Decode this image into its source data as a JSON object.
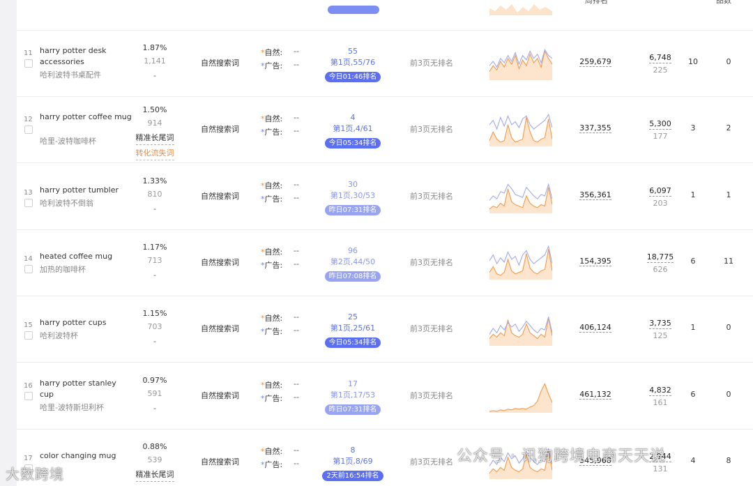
{
  "header": {
    "search_rank_label": "周排名",
    "last_col_label": "品数"
  },
  "labels": {
    "natural": "自然:",
    "ad": "广告:",
    "no_rank": "前3页无排名",
    "star": "*"
  },
  "rows": [
    {
      "index": "11",
      "keyword": "harry potter desk accessories",
      "translation": "哈利波特书桌配件",
      "ratio": "1.87%",
      "count": "1,141",
      "tag1": "-",
      "tag2": "",
      "type": "自然搜索词",
      "natural_val": "--",
      "ad_val": "--",
      "rank": "55",
      "rank_page": "第1页,55/76",
      "rank_time": "今日01:46排名",
      "rank_today": true,
      "search_volume": "259,679",
      "pw_a": "6,748",
      "pw_b": "225",
      "c1": "10",
      "c2": "0",
      "trend_orange": [
        12,
        20,
        14,
        26,
        18,
        30,
        22,
        34,
        16,
        28,
        20,
        36,
        24,
        30,
        18,
        40,
        30,
        22
      ],
      "trend_blue": [
        20,
        26,
        18,
        30,
        24,
        34,
        26,
        38,
        22,
        34,
        28,
        40,
        30,
        36,
        24,
        42,
        34,
        30
      ]
    },
    {
      "index": "12",
      "keyword": "harry potter coffee mug",
      "translation": "哈里-波特咖啡杯",
      "ratio": "1.50%",
      "count": "914",
      "tag1": "精准长尾词",
      "tag2": "转化流失词",
      "type": "自然搜索词",
      "natural_val": "--",
      "ad_val": "--",
      "rank": "4",
      "rank_page": "第1页,4/61",
      "rank_time": "今日05:34排名",
      "rank_today": true,
      "search_volume": "337,355",
      "pw_a": "5,300",
      "pw_b": "177",
      "c1": "3",
      "c2": "2",
      "trend_orange": [
        8,
        20,
        10,
        6,
        8,
        30,
        12,
        6,
        8,
        10,
        40,
        20,
        8,
        6,
        10,
        12,
        38,
        10
      ],
      "trend_blue": [
        30,
        36,
        24,
        40,
        28,
        42,
        30,
        34,
        26,
        38,
        42,
        30,
        24,
        28,
        32,
        36,
        44,
        26
      ]
    },
    {
      "index": "13",
      "keyword": "harry potter tumbler",
      "translation": "哈利波特不倒翁",
      "ratio": "1.33%",
      "count": "810",
      "tag1": "-",
      "tag2": "",
      "type": "自然搜索词",
      "natural_val": "--",
      "ad_val": "--",
      "rank": "30",
      "rank_page": "第1页,30/53",
      "rank_time": "昨日07:31排名",
      "rank_today": false,
      "search_volume": "356,361",
      "pw_a": "6,097",
      "pw_b": "203",
      "c1": "1",
      "c2": "1",
      "trend_orange": [
        6,
        10,
        8,
        14,
        10,
        34,
        16,
        12,
        10,
        8,
        24,
        14,
        10,
        8,
        12,
        10,
        36,
        12
      ],
      "trend_blue": [
        18,
        24,
        20,
        30,
        28,
        40,
        34,
        26,
        24,
        22,
        36,
        30,
        24,
        20,
        26,
        24,
        40,
        20
      ]
    },
    {
      "index": "14",
      "keyword": "heated coffee mug",
      "translation": "加热的咖啡杯",
      "ratio": "1.17%",
      "count": "713",
      "tag1": "-",
      "tag2": "",
      "type": "自然搜索词",
      "natural_val": "--",
      "ad_val": "--",
      "rank": "96",
      "rank_page": "第2页,44/50",
      "rank_time": "昨日07:08排名",
      "rank_today": false,
      "search_volume": "154,395",
      "pw_a": "18,775",
      "pw_b": "626",
      "c1": "6",
      "c2": "11",
      "trend_orange": [
        10,
        18,
        8,
        6,
        10,
        28,
        12,
        8,
        10,
        12,
        36,
        16,
        10,
        8,
        12,
        14,
        42,
        12
      ],
      "trend_blue": [
        26,
        34,
        22,
        30,
        24,
        38,
        28,
        32,
        20,
        34,
        40,
        28,
        22,
        26,
        30,
        34,
        46,
        22
      ]
    },
    {
      "index": "15",
      "keyword": "harry potter cups",
      "translation": "哈利波特杯",
      "ratio": "1.15%",
      "count": "703",
      "tag1": "-",
      "tag2": "",
      "type": "自然搜索词",
      "natural_val": "--",
      "ad_val": "--",
      "rank": "25",
      "rank_page": "第1页,25/61",
      "rank_time": "今日05:34排名",
      "rank_today": true,
      "search_volume": "406,124",
      "pw_a": "3,735",
      "pw_b": "125",
      "c1": "1",
      "c2": "0",
      "trend_orange": [
        10,
        16,
        12,
        18,
        14,
        36,
        18,
        14,
        12,
        16,
        30,
        18,
        14,
        10,
        16,
        12,
        38,
        14
      ],
      "trend_blue": [
        16,
        24,
        18,
        28,
        22,
        32,
        26,
        30,
        20,
        26,
        34,
        28,
        22,
        18,
        24,
        22,
        40,
        18
      ]
    },
    {
      "index": "16",
      "keyword": "harry potter stanley cup",
      "translation": "哈里-波特斯坦利杯",
      "ratio": "0.97%",
      "count": "591",
      "tag1": "-",
      "tag2": "",
      "type": "自然搜索词",
      "natural_val": "--",
      "ad_val": "--",
      "rank": "17",
      "rank_page": "第1页,17/53",
      "rank_time": "昨日07:31排名",
      "rank_today": false,
      "search_volume": "461,132",
      "pw_a": "4,832",
      "pw_b": "161",
      "c1": "6",
      "c2": "0",
      "trend_orange": [
        2,
        3,
        2,
        4,
        3,
        5,
        4,
        6,
        5,
        6,
        5,
        8,
        10,
        16,
        30,
        40,
        26,
        14
      ],
      "trend_blue": []
    },
    {
      "index": "17",
      "keyword": "color changing mug",
      "translation": "",
      "ratio": "0.88%",
      "count": "539",
      "tag1": "精准长尾词",
      "tag2": "",
      "type": "自然搜索词",
      "natural_val": "--",
      "ad_val": "--",
      "rank": "8",
      "rank_page": "第1页,8/69",
      "rank_time": "2天前16:54排名",
      "rank_today": true,
      "search_volume": "545,968",
      "pw_a": "2,944",
      "pw_b": "131",
      "c1": "4",
      "c2": "8",
      "trend_orange": [
        8,
        14,
        10,
        16,
        12,
        30,
        16,
        12,
        10,
        14,
        34,
        16,
        12,
        10,
        14,
        12,
        40,
        12
      ],
      "trend_blue": [
        18,
        26,
        20,
        30,
        24,
        36,
        28,
        32,
        22,
        28,
        38,
        30,
        24,
        20,
        26,
        24,
        42,
        20
      ]
    }
  ],
  "watermarks": {
    "account": "公众号 · 讯狗跨境电商天天说",
    "brand": "大数跨境"
  }
}
